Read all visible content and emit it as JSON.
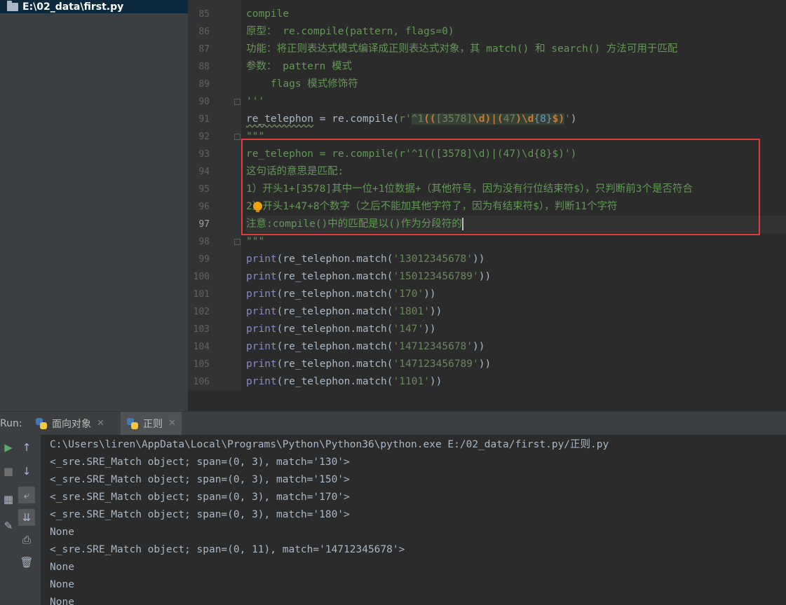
{
  "project": {
    "path_label": "E:\\02_data\\first.py"
  },
  "editor": {
    "lines": [
      {
        "num": "85",
        "segments": [
          {
            "t": "compile",
            "c": "cm"
          }
        ]
      },
      {
        "num": "86",
        "segments": [
          {
            "t": "原型： re.compile(pattern, flags=0)",
            "c": "cm"
          }
        ]
      },
      {
        "num": "87",
        "segments": [
          {
            "t": "功能：将正则表达式模式编译成正则表达式对象，其 match() 和 search() 方法可用于匹配",
            "c": "cm"
          }
        ]
      },
      {
        "num": "88",
        "segments": [
          {
            "t": "参数： pattern 模式",
            "c": "cm"
          }
        ]
      },
      {
        "num": "89",
        "segments": [
          {
            "t": "    flags 模式修饰符",
            "c": "cm"
          }
        ]
      },
      {
        "num": "90",
        "segments": [
          {
            "t": "'''",
            "c": "cm"
          }
        ]
      },
      {
        "num": "91",
        "segments": [
          {
            "t": "re_telephon",
            "c": "n ul"
          },
          {
            "t": " = re.compile(",
            "c": "n"
          },
          {
            "t": "r'",
            "c": "s"
          },
          {
            "t": "^1",
            "c": "rx"
          },
          {
            "t": "((",
            "c": "rx rxb"
          },
          {
            "t": "[3578]",
            "c": "rx"
          },
          {
            "t": "\\d",
            "c": "rx rxb"
          },
          {
            "t": ")|(",
            "c": "rx rxb"
          },
          {
            "t": "47",
            "c": "rx"
          },
          {
            "t": ")",
            "c": "rx rxb"
          },
          {
            "t": "\\d",
            "c": "rx rxb"
          },
          {
            "t": "{8}",
            "c": "rx rxn"
          },
          {
            "t": "$)",
            "c": "rx rxb"
          },
          {
            "t": "'",
            "c": "s"
          },
          {
            "t": ")",
            "c": "n"
          }
        ]
      },
      {
        "num": "92",
        "segments": [
          {
            "t": "\"\"\"",
            "c": "cm"
          }
        ]
      },
      {
        "num": "93",
        "segments": [
          {
            "t": "re_telephon = re.compile(r'^1(([3578]\\d)|(47)\\d{8}$)')",
            "c": "cm"
          }
        ]
      },
      {
        "num": "94",
        "segments": [
          {
            "t": "这句话的意思是匹配:",
            "c": "cm"
          }
        ]
      },
      {
        "num": "95",
        "segments": [
          {
            "t": "1）开头1+[3578]其中一位+1位数据+（其他符号，因为没有行位结束符$），只判断前3个是否符合",
            "c": "cm"
          }
        ]
      },
      {
        "num": "96",
        "segments": [
          {
            "t": "2）开头1+47+8个数字（之后不能加其他字符了，因为有结束符$），判断11个字符",
            "c": "cm"
          }
        ]
      },
      {
        "num": "97",
        "segments": [
          {
            "t": "注意:compile()中的匹配是以()作为分段符的",
            "c": "cm"
          }
        ],
        "current": true
      },
      {
        "num": "98",
        "segments": [
          {
            "t": "\"\"\"",
            "c": "cm"
          }
        ]
      },
      {
        "num": "99",
        "segments": [
          {
            "t": "print",
            "c": "b"
          },
          {
            "t": "(re_telephon.match(",
            "c": "n"
          },
          {
            "t": "'13012345678'",
            "c": "s"
          },
          {
            "t": "))",
            "c": "n"
          }
        ]
      },
      {
        "num": "100",
        "segments": [
          {
            "t": "print",
            "c": "b"
          },
          {
            "t": "(re_telephon.match(",
            "c": "n"
          },
          {
            "t": "'150123456789'",
            "c": "s"
          },
          {
            "t": "))",
            "c": "n"
          }
        ]
      },
      {
        "num": "101",
        "segments": [
          {
            "t": "print",
            "c": "b"
          },
          {
            "t": "(re_telephon.match(",
            "c": "n"
          },
          {
            "t": "'170'",
            "c": "s"
          },
          {
            "t": "))",
            "c": "n"
          }
        ]
      },
      {
        "num": "102",
        "segments": [
          {
            "t": "print",
            "c": "b"
          },
          {
            "t": "(re_telephon.match(",
            "c": "n"
          },
          {
            "t": "'1801'",
            "c": "s"
          },
          {
            "t": "))",
            "c": "n"
          }
        ]
      },
      {
        "num": "103",
        "segments": [
          {
            "t": "print",
            "c": "b"
          },
          {
            "t": "(re_telephon.match(",
            "c": "n"
          },
          {
            "t": "'147'",
            "c": "s"
          },
          {
            "t": "))",
            "c": "n"
          }
        ]
      },
      {
        "num": "104",
        "segments": [
          {
            "t": "print",
            "c": "b"
          },
          {
            "t": "(re_telephon.match(",
            "c": "n"
          },
          {
            "t": "'14712345678'",
            "c": "s"
          },
          {
            "t": "))",
            "c": "n"
          }
        ]
      },
      {
        "num": "105",
        "segments": [
          {
            "t": "print",
            "c": "b"
          },
          {
            "t": "(re_telephon.match(",
            "c": "n"
          },
          {
            "t": "'147123456789'",
            "c": "s"
          },
          {
            "t": "))",
            "c": "n"
          }
        ]
      },
      {
        "num": "106",
        "segments": [
          {
            "t": "print",
            "c": "b"
          },
          {
            "t": "(re_telephon.match(",
            "c": "n"
          },
          {
            "t": "'1101'",
            "c": "s"
          },
          {
            "t": "))",
            "c": "n"
          }
        ]
      }
    ]
  },
  "run": {
    "label": "Run:",
    "tabs": [
      {
        "label": "面向对象",
        "close": "✕",
        "active": false
      },
      {
        "label": "正则",
        "close": "✕",
        "active": true
      }
    ],
    "toolbar_icons": [
      "run-icon",
      "up-arrow-icon",
      "stop-icon",
      "down-arrow-icon",
      "soft-wrap-icon",
      "layout-icon",
      "scroll-to-end-icon",
      "pin-icon",
      "print-icon",
      "trash-icon"
    ],
    "console_lines": [
      "C:\\Users\\liren\\AppData\\Local\\Programs\\Python\\Python36\\python.exe E:/02_data/first.py/正则.py",
      "<_sre.SRE_Match object; span=(0, 3), match='130'>",
      "<_sre.SRE_Match object; span=(0, 3), match='150'>",
      "<_sre.SRE_Match object; span=(0, 3), match='170'>",
      "<_sre.SRE_Match object; span=(0, 3), match='180'>",
      "None",
      "<_sre.SRE_Match object; span=(0, 11), match='14712345678'>",
      "None",
      "None",
      "None"
    ]
  },
  "colors": {
    "editor_bg": "#2b2b2b",
    "comment": "#629755",
    "string": "#6a8759",
    "builtin": "#8888c6",
    "highlight_box": "#e03d3d"
  }
}
